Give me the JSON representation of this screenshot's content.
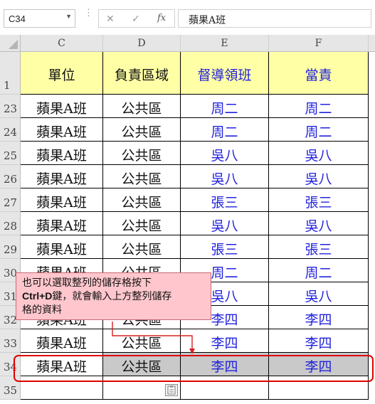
{
  "formula_bar": {
    "name_box": "C34",
    "cancel_icon": "✕",
    "enter_icon": "✓",
    "fx_label": "fx",
    "content": "蘋果A班"
  },
  "columns": [
    "C",
    "D",
    "E",
    "F"
  ],
  "header_row": {
    "row_number": "1",
    "cells": [
      "單位",
      "負責區域",
      "督導領班",
      "當責"
    ]
  },
  "rows": [
    {
      "row_number": "23",
      "cells": [
        "蘋果A班",
        "公共區",
        "周二",
        "周二"
      ]
    },
    {
      "row_number": "24",
      "cells": [
        "蘋果A班",
        "公共區",
        "周二",
        "周二"
      ]
    },
    {
      "row_number": "25",
      "cells": [
        "蘋果A班",
        "公共區",
        "吳八",
        "吳八"
      ]
    },
    {
      "row_number": "26",
      "cells": [
        "蘋果A班",
        "公共區",
        "吳八",
        "吳八"
      ]
    },
    {
      "row_number": "27",
      "cells": [
        "蘋果A班",
        "公共區",
        "張三",
        "張三"
      ]
    },
    {
      "row_number": "28",
      "cells": [
        "蘋果A班",
        "公共區",
        "吳八",
        "吳八"
      ]
    },
    {
      "row_number": "29",
      "cells": [
        "蘋果A班",
        "公共區",
        "張三",
        "張三"
      ]
    },
    {
      "row_number": "30",
      "cells": [
        "蘋果A班",
        "公共區",
        "周二",
        "周二"
      ]
    },
    {
      "row_number": "31",
      "cells": [
        "蘋果A班",
        "公共區",
        "吳八",
        "吳八"
      ]
    },
    {
      "row_number": "32",
      "cells": [
        "蘋果A班",
        "公共區",
        "李四",
        "李四"
      ]
    },
    {
      "row_number": "33",
      "cells": [
        "蘋果A班",
        "公共區",
        "李四",
        "李四"
      ]
    },
    {
      "row_number": "34",
      "cells": [
        "蘋果A班",
        "公共區",
        "李四",
        "李四"
      ]
    },
    {
      "row_number": "35",
      "cells": [
        "",
        "",
        "",
        ""
      ]
    }
  ],
  "callout": {
    "line1": "也可以選取整列的儲存格按下",
    "line2_bold": "Ctrl+D",
    "line2_rest": "鍵，就會輸入上方整列儲存",
    "line3": "格的資料"
  },
  "colors": {
    "header_fill": "#ffffa6",
    "name_text": "#2222dd",
    "selection_fill": "#c9c9c9",
    "callout_fill": "#ffc7cd",
    "highlight_outline": "#e00000"
  },
  "paste_options_icon": "paste-options-icon"
}
